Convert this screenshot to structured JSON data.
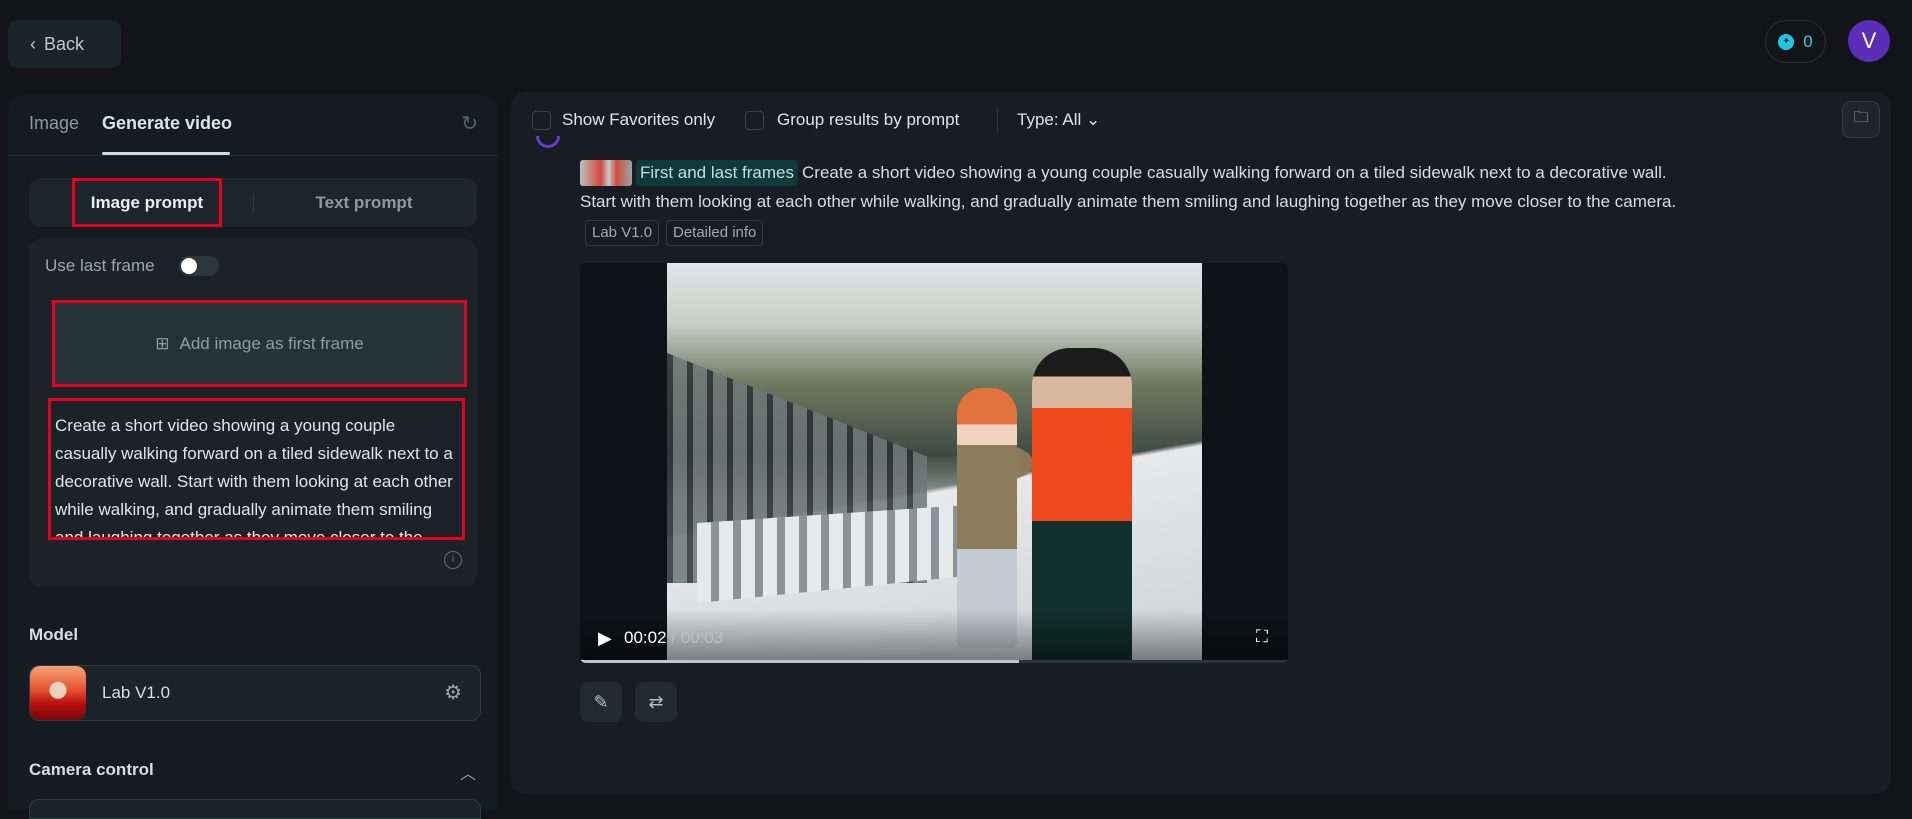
{
  "header": {
    "back_label": "Back",
    "credits": "0",
    "avatar_initial": "V"
  },
  "left": {
    "tabs": [
      {
        "label": "Image"
      },
      {
        "label": "Generate video"
      }
    ],
    "prompt_modes": [
      {
        "label": "Image prompt"
      },
      {
        "label": "Text prompt"
      }
    ],
    "use_last_frame_label": "Use last frame",
    "use_last_frame_on": false,
    "add_image_label": "Add image as first frame",
    "prompt_text": "Create a short video showing a young couple casually walking forward on a tiled sidewalk next to a decorative wall. Start with them looking at each other while walking, and gradually animate them smiling and laughing together as they move closer to the camera.",
    "model_label": "Model",
    "model_name": "Lab V1.0",
    "camera_label": "Camera control"
  },
  "results": {
    "show_favorites_label": "Show Favorites only",
    "group_label": "Group results by prompt",
    "type_label": "Type: All",
    "chip": "First and last frames",
    "prompt_line1": "Create a short video showing a young couple casually walking forward on a tiled sidewalk next to a decorative wall.",
    "prompt_line2": "Start with them looking at each other while walking, and gradually animate them smiling and laughing together as they move closer to the camera.",
    "tags": [
      "Lab V1.0",
      "Detailed info"
    ],
    "video": {
      "current_time": "00:02",
      "separator": " / ",
      "duration": "00:03",
      "progress": 0.62
    }
  }
}
